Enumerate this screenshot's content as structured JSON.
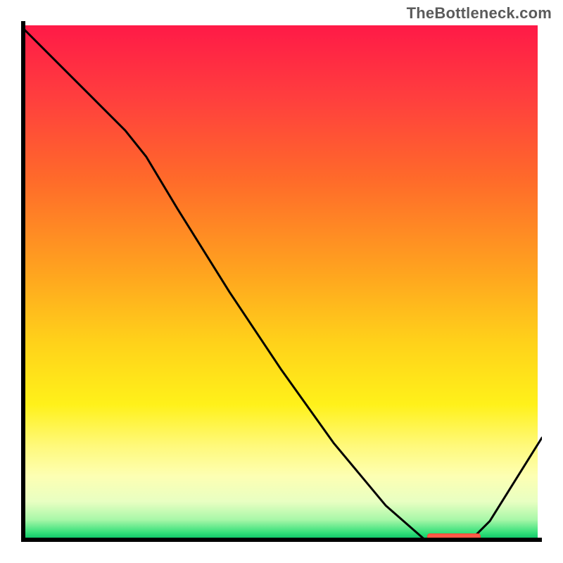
{
  "attribution": "TheBottleneck.com",
  "colors": {
    "gradient_top": "#ff1a47",
    "gradient_mid": "#ffd21a",
    "gradient_bottom": "#13c96b",
    "axis": "#000000",
    "curve": "#000000",
    "marker": "#ff5a48"
  },
  "chart_data": {
    "type": "line",
    "title": "",
    "xlabel": "",
    "ylabel": "",
    "xlim": [
      0,
      100
    ],
    "ylim": [
      0,
      100
    ],
    "series": [
      {
        "name": "bottleneck-curve",
        "x": [
          0,
          5,
          10,
          15,
          20,
          24,
          30,
          40,
          50,
          60,
          70,
          78,
          82,
          86,
          90,
          95,
          100
        ],
        "values": [
          99,
          94,
          89,
          84,
          79,
          74,
          64,
          48,
          33,
          19,
          7,
          0,
          0,
          0,
          4,
          12,
          20
        ]
      }
    ],
    "marker": {
      "x_start": 78,
      "x_end": 88,
      "y": 0,
      "label": ""
    },
    "grid": false,
    "legend_position": "none"
  }
}
